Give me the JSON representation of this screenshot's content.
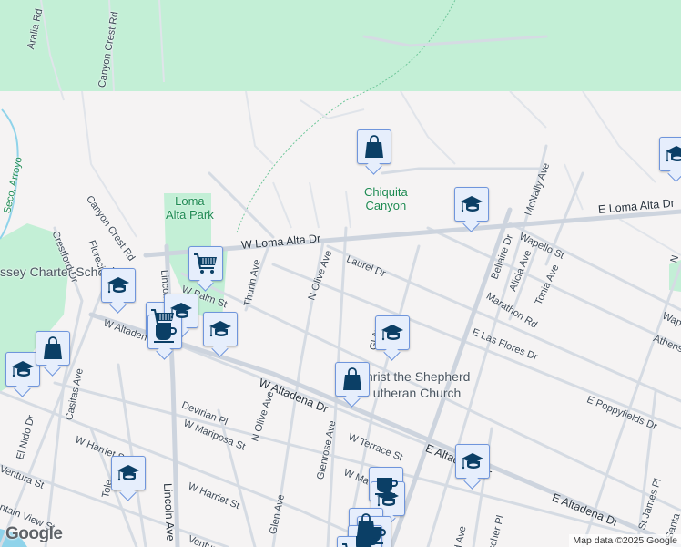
{
  "map": {
    "streets": {
      "aralia": "Aralia Rd",
      "canyon_crest_1": "Canyon Crest Rd",
      "canyon_crest_2": "Canyon Crest Rd",
      "seco_arroyo": "Seco, Arroyo",
      "crestford": "Crestford Dr",
      "florecita": "Florecita Dr",
      "lincoln_1": "Lincoln Ave",
      "lincoln_2": "Lincoln Ave",
      "w_loma_alta": "W Loma Alta Dr",
      "e_loma_alta": "E Loma Alta Dr",
      "thurin": "Thurin Ave",
      "n_olive_1": "N Olive Ave",
      "n_olive_2": "N Olive Ave",
      "laurel": "Laurel Dr",
      "w_palm": "W Palm St",
      "w_altadena_1": "W Altadena Dr",
      "w_altadena_2": "W Altadena Dr",
      "e_altadena_1": "E Altadena Dr",
      "e_altadena_2": "E Altadena Dr",
      "mcnally": "McNally Ave",
      "wapello_1": "Wapello St",
      "wapello_2": "Wap",
      "bellaire": "Bellaire Dr",
      "alicia": "Alicia Ave",
      "tonia": "Tonia Ave",
      "marathon": "Marathon Rd",
      "e_las_flores": "E Las Flores Dr",
      "athens": "Athens",
      "e_poppyfields": "E Poppyfields Dr",
      "glenrose_1": "Glenrose Ave",
      "glenrose_2": "Gl      Ave",
      "devirian": "Devirian Pl",
      "w_mariposa_1": "W Mariposa St",
      "w_mariposa_2": "W Ma",
      "w_terrace": "W Terrace St",
      "casitas": "Casitas Ave",
      "el_nido": "El Nido Dr",
      "w_harriet_1": "W Harriet St",
      "w_harriet_2": "W Harriet St",
      "ventura_1": "Ventura St",
      "ventura_2": "Ventura St",
      "mountain_view": "ntain View St",
      "glen": "Glen Ave",
      "st_james": "St James Pl",
      "fischer": "scher Pl",
      "santa": "Santa",
      "n_cut": "N",
      "tole": "Tole",
      "cut_ave": "d Ave"
    },
    "places": {
      "loma_alta_park": "Loma\nAlta Park",
      "chiquita_canyon": "Chiquita\nCanyon",
      "charter_school": "ssey Charter School",
      "church": "hrist the Shepherd\nLutheran Church"
    },
    "markers": [
      {
        "type": "shopping-bag"
      },
      {
        "type": "school"
      },
      {
        "type": "school"
      },
      {
        "type": "cart"
      },
      {
        "type": "school"
      },
      {
        "type": "cart"
      },
      {
        "type": "school"
      },
      {
        "type": "coffee"
      },
      {
        "type": "school"
      },
      {
        "type": "shopping-bag"
      },
      {
        "type": "school"
      },
      {
        "type": "school"
      },
      {
        "type": "shopping-bag"
      },
      {
        "type": "school"
      },
      {
        "type": "school"
      },
      {
        "type": "coffee"
      },
      {
        "type": "school"
      },
      {
        "type": "shopping-bag"
      },
      {
        "type": "coffee"
      },
      {
        "type": "coffee"
      },
      {
        "type": "cart"
      }
    ],
    "logo": "Google",
    "attribution": "Map data ©2025 Google",
    "colors": {
      "park": "#c3efd6",
      "land": "#f5f3f3",
      "road": "#d5dbe3",
      "marker_fill": "#e6eefc",
      "marker_border": "#6f95dc",
      "icon": "#0b3f66",
      "water": "#8fd3ea"
    }
  }
}
